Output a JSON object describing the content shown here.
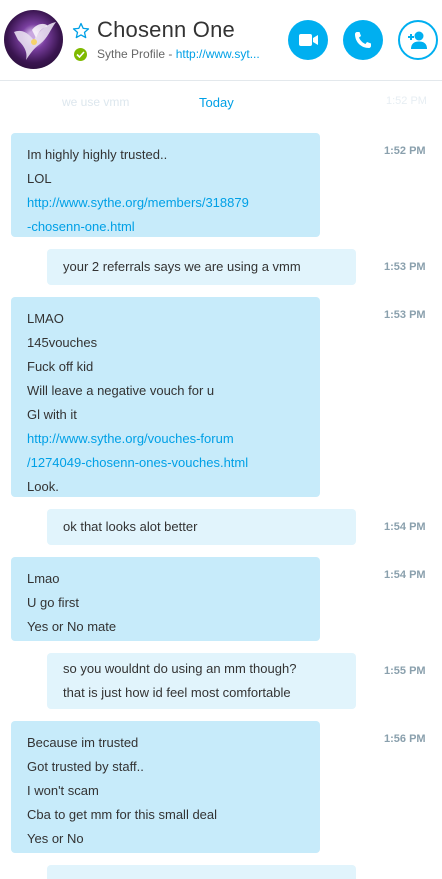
{
  "header": {
    "contact_name": "Chosenn One",
    "profile_label": "Sythe Profile - ",
    "profile_link": "http://www.syt...",
    "colors": {
      "accent": "#00aff0",
      "online": "#7fba00"
    }
  },
  "conversation": {
    "ghost_text": "we use vmm",
    "ghost_time": "1:52 PM",
    "date_divider": "Today",
    "messages": [
      {
        "dir": "in",
        "time": "1:52 PM",
        "lines": [
          "Im highly highly trusted..",
          "LOL",
          "http://www.sythe.org/members/318879",
          "-chosenn-one.html"
        ]
      },
      {
        "dir": "out",
        "time": "1:53 PM",
        "lines": [
          "your 2 referrals says we are using a vmm"
        ]
      },
      {
        "dir": "in",
        "time": "1:53 PM",
        "lines": [
          "LMAO",
          "145vouches",
          "Fuck off kid",
          "Will leave a negative vouch for u",
          "Gl with it",
          "http://www.sythe.org/vouches-forum",
          "/1274049-chosenn-ones-vouches.html",
          "Look."
        ]
      },
      {
        "dir": "out",
        "time": "1:54 PM",
        "lines": [
          "ok that looks alot better"
        ]
      },
      {
        "dir": "in",
        "time": "1:54 PM",
        "lines": [
          "Lmao",
          "U go first",
          "Yes or No mate"
        ]
      },
      {
        "dir": "out",
        "time": "1:55 PM",
        "lines": [
          "so you wouldnt do using an mm though?",
          "that is just how id feel most comfortable"
        ]
      },
      {
        "dir": "in",
        "time": "1:56 PM",
        "lines": [
          "Because im trusted",
          "Got trusted by staff..",
          "I won't scam",
          "Cba to get mm for this small deal",
          "Yes or No"
        ]
      }
    ]
  }
}
